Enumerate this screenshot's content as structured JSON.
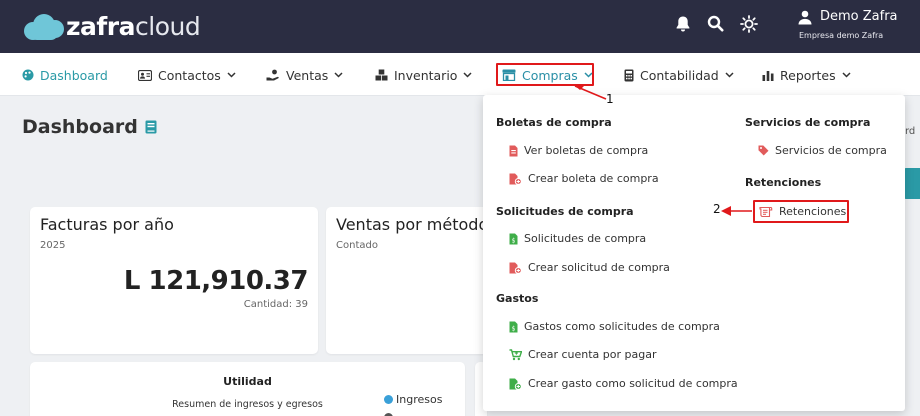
{
  "brand": {
    "name_bold": "zafra",
    "name_light": "cloud"
  },
  "topbar": {
    "icons": [
      "bell-icon",
      "search-icon",
      "sun-icon"
    ],
    "user": {
      "name": "Demo Zafra",
      "company": "Empresa demo Zafra"
    }
  },
  "nav": {
    "items": [
      {
        "label": "Dashboard",
        "icon": "palette-icon",
        "active": true,
        "has_dropdown": false
      },
      {
        "label": "Contactos",
        "icon": "id-card-icon",
        "has_dropdown": true
      },
      {
        "label": "Ventas",
        "icon": "hand-coin-icon",
        "has_dropdown": true
      },
      {
        "label": "Inventario",
        "icon": "boxes-icon",
        "has_dropdown": true
      },
      {
        "label": "Compras",
        "icon": "store-icon",
        "has_dropdown": true,
        "open": true
      },
      {
        "label": "Contabilidad",
        "icon": "calculator-icon",
        "has_dropdown": true
      },
      {
        "label": "Reportes",
        "icon": "bar-chart-icon",
        "has_dropdown": true
      }
    ]
  },
  "page": {
    "title": "Dashboard",
    "right_fragment": "rd"
  },
  "cards": {
    "facturas": {
      "title": "Facturas por año",
      "year": "2025",
      "amount": "L 121,910.37",
      "count": "Cantidad: 39"
    },
    "ventas": {
      "title": "Ventas por método",
      "sub": "Contado"
    },
    "utilidad": {
      "title": "Utilidad",
      "sub": "Resumen de ingresos y egresos",
      "legend": [
        {
          "label": "Ingresos",
          "color": "#3aa0d8"
        }
      ]
    }
  },
  "dropdown": {
    "colors": {
      "red": "#e15b5b",
      "green": "#3fae49",
      "teal": "#2a9aa6"
    },
    "sections": {
      "boletas": {
        "title": "Boletas de compra",
        "items": [
          "Ver boletas de compra",
          "Crear boleta de compra"
        ]
      },
      "solicitudes": {
        "title": "Solicitudes de compra",
        "items": [
          "Solicitudes de compra",
          "Crear solicitud de compra"
        ]
      },
      "gastos": {
        "title": "Gastos",
        "items": [
          "Gastos como solicitudes de compra",
          "Crear cuenta por pagar",
          "Crear gasto como solicitud de compra"
        ]
      },
      "servicios": {
        "title": "Servicios de compra",
        "items": [
          "Servicios de compra"
        ]
      },
      "retenciones": {
        "title": "Retenciones",
        "items": [
          "Retenciones"
        ]
      }
    }
  },
  "annotations": {
    "one": "1",
    "two": "2",
    "color": "#e0191b"
  }
}
